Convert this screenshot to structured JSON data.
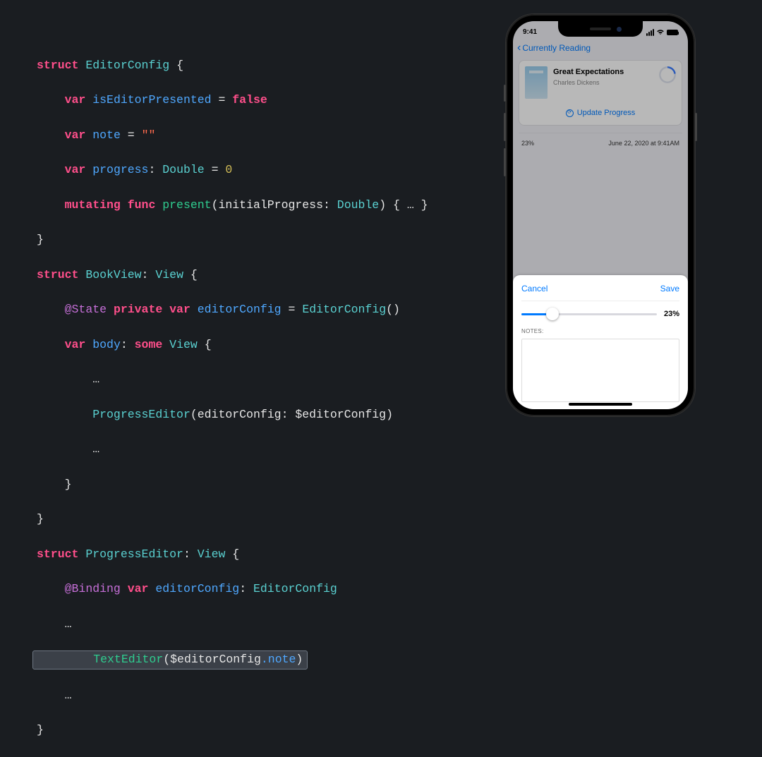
{
  "code": {
    "s1": {
      "kw_struct": "struct",
      "name": "EditorConfig",
      "brace": "{",
      "l1_kw": "var",
      "l1_id": "isEditorPresented",
      "l1_eq": "=",
      "l1_val": "false",
      "l2_kw": "var",
      "l2_id": "note",
      "l2_eq": "=",
      "l2_val": "\"\"",
      "l3_kw": "var",
      "l3_id": "progress",
      "l3_colon_type": ": Double =",
      "l3_type": "Double",
      "l3_eq": "=",
      "l3_val": "0",
      "l4_kw1": "mutating",
      "l4_kw2": "func",
      "l4_fn": "present",
      "l4_sig_open": "(initialProgress:",
      "l4_arg_type": "Double",
      "l4_sig_close": ") { … }",
      "close": "}"
    },
    "s2": {
      "kw_struct": "struct",
      "name": "BookView",
      "colon": ":",
      "proto": "View",
      "brace": "{",
      "l1_pw": "@State",
      "l1_kw": "private var",
      "l1_id": "editorConfig",
      "l1_eq": "=",
      "l1_ctor": "EditorConfig",
      "l1_call": "()",
      "l2_kw": "var",
      "l2_id": "body",
      "l2_colon": ":",
      "l2_some": "some",
      "l2_view": "View",
      "l2_brace": "{",
      "ell": "…",
      "pe_fn": "ProgressEditor",
      "pe_arg": "(editorConfig: $editorConfig)",
      "close_body": "}",
      "close": "}"
    },
    "s3": {
      "kw_struct": "struct",
      "name": "ProgressEditor",
      "colon": ":",
      "proto": "View",
      "brace": "{",
      "l1_pw": "@Binding",
      "l1_kw": "var",
      "l1_id": "editorConfig",
      "l1_colon": ":",
      "l1_type": "EditorConfig",
      "ell": "…",
      "te_fn": "TextEditor",
      "te_arg_open": "(",
      "te_arg_inner": "$editorConfig",
      "te_arg_prop": ".note",
      "te_arg_close": ")",
      "close": "}"
    }
  },
  "phone": {
    "time": "9:41",
    "back_label": "Currently Reading",
    "book_title": "Great Expectations",
    "book_author": "Charles Dickens",
    "update_label": "Update Progress",
    "row_pct": "23%",
    "row_date": "June 22, 2020 at 9:41AM",
    "sheet_cancel": "Cancel",
    "sheet_save": "Save",
    "sheet_pct": "23%",
    "notes_label": "NOTES:"
  }
}
